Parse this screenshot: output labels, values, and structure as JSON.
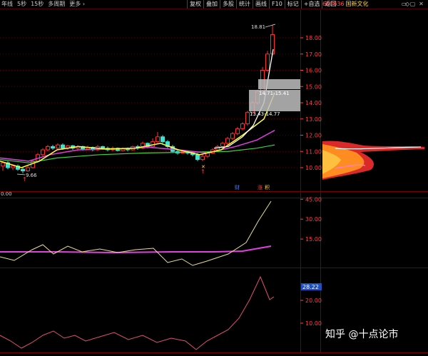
{
  "toolbar": {
    "left_items": [
      "年线",
      "5秒",
      "15秒",
      "多周期",
      "更多 ›"
    ],
    "right_items": [
      "复权",
      "叠加",
      "多股",
      "统计",
      "画线",
      "F10",
      "标记",
      "+自选",
      "返回"
    ]
  },
  "stock": {
    "code": "600636",
    "name": "国新文化"
  },
  "main_panel": {
    "y_ticks": [
      "18.00",
      "17.00",
      "16.00",
      "15.00",
      "14.00",
      "13.00",
      "12.00",
      "11.00",
      "10.00"
    ],
    "price_high_label": "18.81",
    "price_low_label": "9.66",
    "box_label_upper": "14.71-15.41",
    "box_label_lower": "13.43-14.77",
    "markers": {
      "cai": "财",
      "zhang": "涨",
      "hong": "积"
    }
  },
  "indicator1": {
    "y_ticks": [
      "45.00",
      "30.00",
      "15.00"
    ],
    "left_label": "0.00"
  },
  "indicator2": {
    "y_ticks": [
      "20.00",
      "10.00"
    ],
    "current_value": "28.22"
  },
  "watermark": "知乎 @十点论市",
  "colors": {
    "up": "#ff3030",
    "down": "#40e0d0",
    "ma_yellow": "#ffff40",
    "ma_white": "#ffffff",
    "ma_magenta": "#e040e0",
    "ma_green": "#40d040"
  }
}
